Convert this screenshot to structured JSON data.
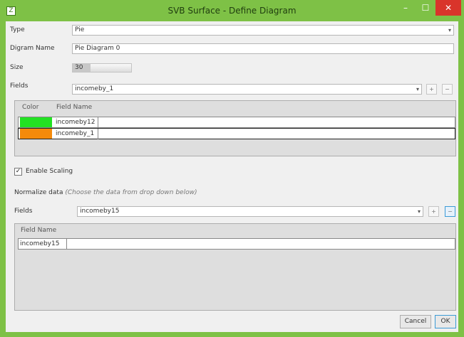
{
  "window": {
    "title": "SVB Surface - Define Diagram",
    "app_icon": "Z",
    "min_glyph": "–",
    "max_glyph": "☐",
    "close_glyph": "✕"
  },
  "form": {
    "type_label": "Type",
    "type_value": "Pie",
    "name_label": "Digram Name",
    "name_value": "Pie Diagram 0",
    "size_label": "Size",
    "size_value": "30",
    "size_fraction": 0.3,
    "fields_label": "Fields",
    "fields_value": "incomeby_1",
    "add_glyph": "+",
    "remove_glyph": "−"
  },
  "fields_table": {
    "headers": [
      "Color",
      "Field Name"
    ],
    "rows": [
      {
        "color": "#22e122",
        "name": "incomeby12"
      },
      {
        "color": "#f58a0b",
        "name": "incomeby_1"
      }
    ]
  },
  "scaling": {
    "label": "Enable Scaling",
    "checked": true,
    "check_glyph": "✓"
  },
  "normalize": {
    "title": "Normalize data",
    "hint": "(Choose the data from drop down below)",
    "fields_label": "Fields",
    "fields_value": "incomeby15",
    "header": "Field Name",
    "rows": [
      "incomeby15"
    ]
  },
  "buttons": {
    "cancel": "Cancel",
    "ok": "OK"
  }
}
